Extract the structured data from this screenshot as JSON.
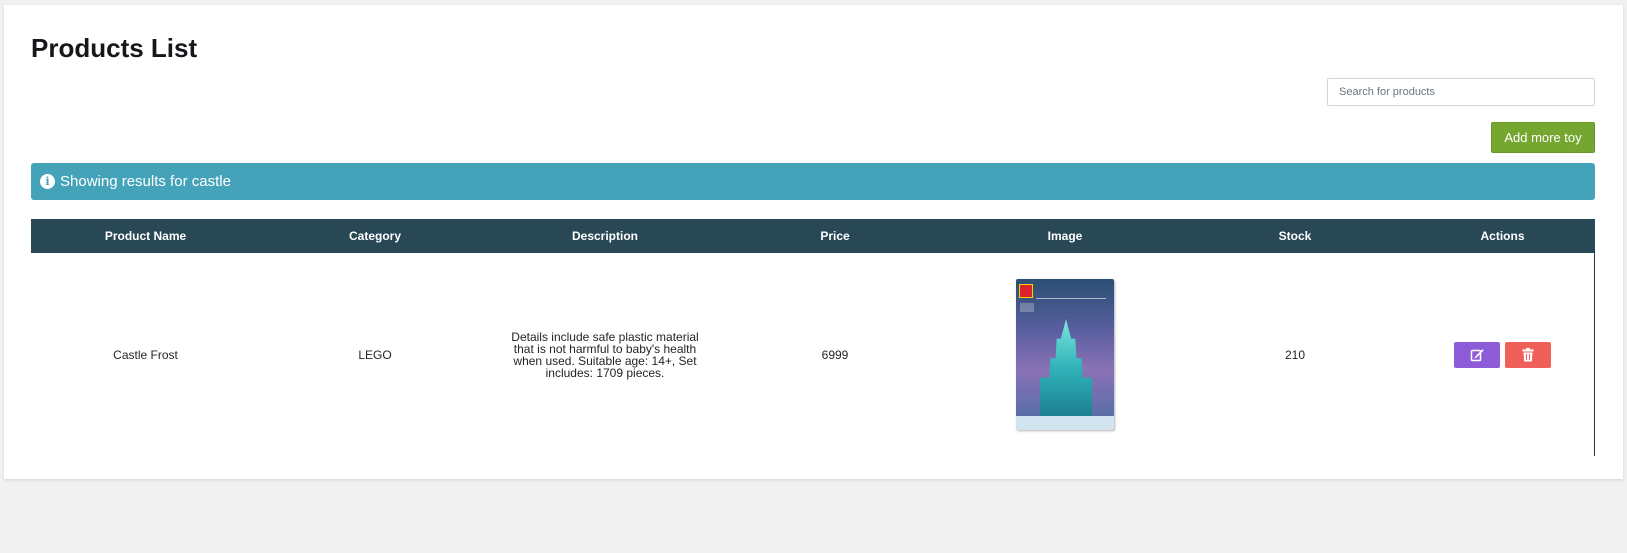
{
  "page": {
    "title": "Products List"
  },
  "search": {
    "placeholder": "Search for products",
    "value": ""
  },
  "toolbar": {
    "add_label": "Add more toy",
    "add_color": "#75a730"
  },
  "alert": {
    "text": "Showing results for castle",
    "icon": "info-circle-icon",
    "color": "#45a3b9"
  },
  "table": {
    "header_color": "#284855",
    "columns": [
      "Product Name",
      "Category",
      "Description",
      "Price",
      "Image",
      "Stock",
      "Actions"
    ],
    "rows": [
      {
        "name": "Castle Frost",
        "category": "LEGO",
        "description": "Details include safe plastic material that is not harmful to baby's health when used. Suitable age: 14+, Set includes: 1709 pieces.",
        "price": "6999",
        "image": "lego-disney-frozen-ice-castle-box",
        "stock": "210",
        "actions": {
          "edit_icon": "edit-icon",
          "edit_color": "#8e5bd8",
          "delete_icon": "trash-icon",
          "delete_color": "#f0605a"
        }
      }
    ]
  }
}
